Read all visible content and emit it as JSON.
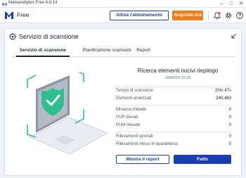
{
  "window": {
    "title": "Malwarebytes Free 4.6.14"
  },
  "header": {
    "edition": "Free",
    "activate_label": "Attiva l'abbonamento",
    "buy_label": "Acquista ora"
  },
  "panel": {
    "title": "Servizio di scansione",
    "tabs": [
      {
        "label": "Servizio di scansione",
        "active": true
      },
      {
        "label": "Pianificazione scansioni",
        "active": false
      },
      {
        "label": "Report",
        "active": false
      }
    ]
  },
  "summary": {
    "title": "Ricerca elementi nocivi riepilogo",
    "date": "18/06/24 12:23",
    "stats": [
      {
        "label": "Tempo di scansione",
        "value": "20m 47s"
      },
      {
        "label": "Elementi analizzati",
        "value": "240.483"
      },
      {
        "label": "Minacce rilevate",
        "value": "0"
      },
      {
        "label": "PUP rilevati",
        "value": "0"
      },
      {
        "label": "PUM rilevate",
        "value": "0"
      },
      {
        "label": "Rilevamenti ignorati",
        "value": "0"
      },
      {
        "label": "Rilevamenti messi in quarantena",
        "value": "0"
      }
    ]
  },
  "actions": {
    "report_label": "Mostra il report",
    "done_label": "Fatto"
  },
  "colors": {
    "brand_blue": "#1b3db3",
    "accent_orange": "#ef7d1b",
    "success_green": "#2fbf8e"
  }
}
